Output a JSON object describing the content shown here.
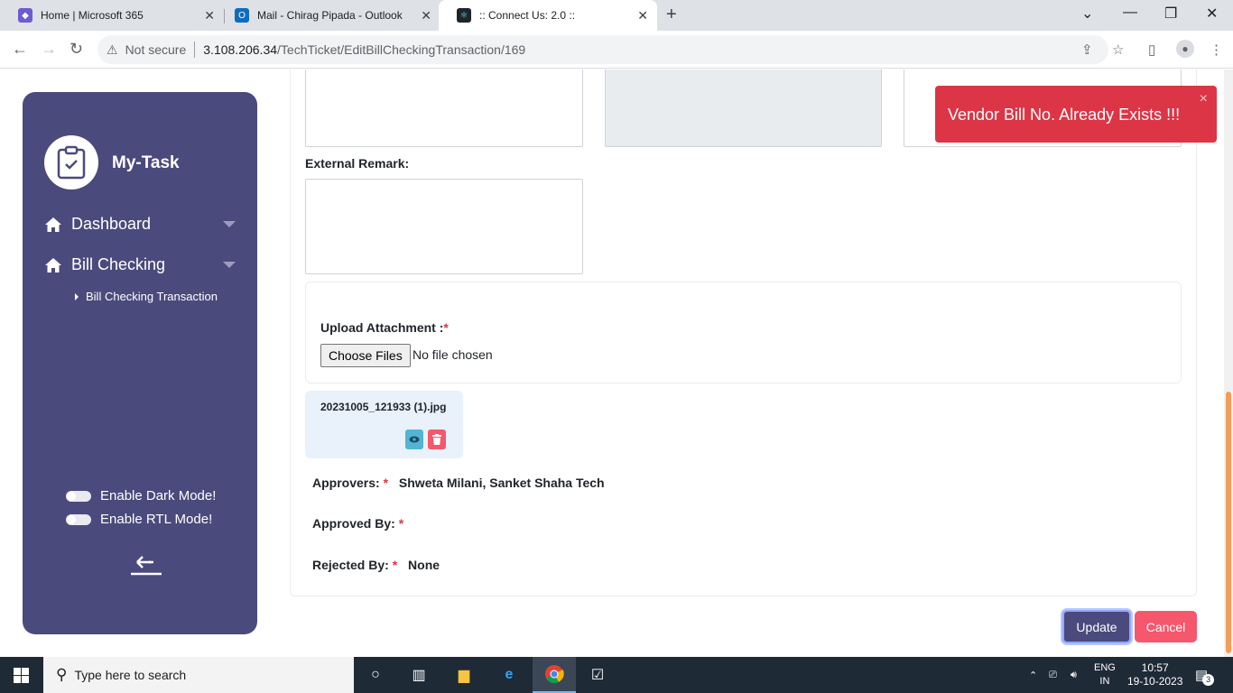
{
  "browser": {
    "tabs": [
      {
        "title": "Home | Microsoft 365"
      },
      {
        "title": "Mail - Chirag Pipada - Outlook"
      },
      {
        "title": ":: Connect Us: 2.0 ::"
      }
    ],
    "security_label": "Not secure",
    "url_host": "3.108.206.34",
    "url_path": "/TechTicket/EditBillCheckingTransaction/169"
  },
  "sidebar": {
    "brand": "My-Task",
    "items": [
      {
        "label": "Dashboard"
      },
      {
        "label": "Bill Checking"
      }
    ],
    "subitem": "Bill Checking Transaction",
    "dark_mode_label": "Enable Dark Mode!",
    "rtl_mode_label": "Enable RTL Mode!"
  },
  "form": {
    "external_remark_label": "External Remark:",
    "upload_label": "Upload Attachment :",
    "required_mark": "*",
    "choose_files": "Choose Files",
    "no_file": "No file chosen",
    "attachment_name": "20231005_121933 (1).jpg",
    "approvers_label": "Approvers:",
    "approvers_value": "Shweta Milani, Sanket Shaha Tech",
    "approved_by_label": "Approved By:",
    "rejected_by_label": "Rejected By:",
    "rejected_by_value": "None",
    "update_button": "Update",
    "cancel_button": "Cancel"
  },
  "toast": {
    "message": "Vendor Bill No. Already Exists !!!",
    "close": "×"
  },
  "taskbar": {
    "search_placeholder": "Type here to search",
    "lang_top": "ENG",
    "lang_bottom": "IN",
    "time": "10:57",
    "date": "19-10-2023",
    "notification_count": "3"
  },
  "colors": {
    "sidebar_bg": "#4b4a7d",
    "toast_bg": "#dc3545",
    "cancel_bg": "#f5576c",
    "scroll_thumb": "#f29d5b"
  }
}
